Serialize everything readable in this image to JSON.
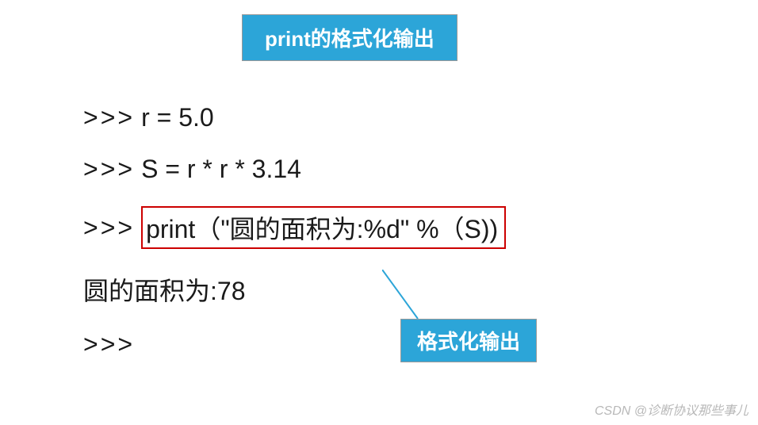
{
  "title": "print的格式化输出",
  "code": {
    "line1_prompt": ">>>",
    "line1_text": "r = 5.0",
    "line2_prompt": ">>>",
    "line2_text": "S = r * r * 3.14",
    "line3_prompt": ">>>",
    "line3_text": "print（\"圆的面积为:%d\"   %（S))",
    "line4_text": "圆的面积为:78",
    "line5_prompt": ">>>"
  },
  "callout": "格式化输出",
  "watermark": "CSDN @诊断协议那些事儿",
  "colors": {
    "box_bg": "#2ca5d8",
    "box_text": "#ffffff",
    "red_border": "#cc0000",
    "text": "#1a1a1a",
    "watermark": "#b8b8b8"
  }
}
